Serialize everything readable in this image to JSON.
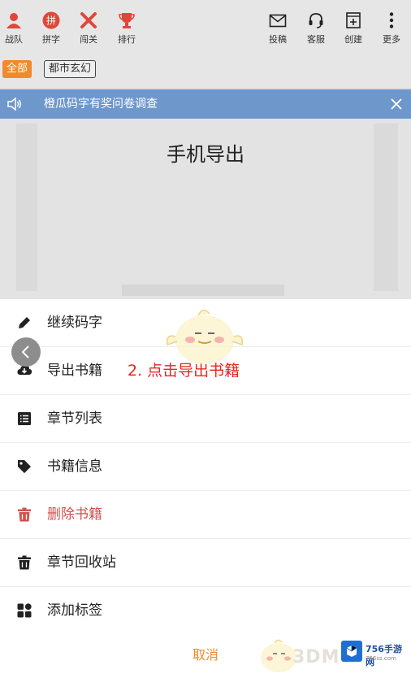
{
  "toolbar_left": [
    {
      "label": "战队",
      "icon": "team-icon"
    },
    {
      "label": "拼字",
      "icon": "pinzi-icon"
    },
    {
      "label": "闯关",
      "icon": "swords-icon"
    },
    {
      "label": "排行",
      "icon": "trophy-icon"
    }
  ],
  "toolbar_right": [
    {
      "label": "投稿",
      "icon": "mail-icon"
    },
    {
      "label": "客服",
      "icon": "headset-icon"
    },
    {
      "label": "创建",
      "icon": "create-icon"
    },
    {
      "label": "更多",
      "icon": "more-icon"
    }
  ],
  "pinzi_glyph": "拼",
  "filters": {
    "all": "全部",
    "genre": "都市玄幻"
  },
  "notice": {
    "text": "橙瓜码字有奖问卷调查"
  },
  "page_title": "手机导出",
  "menu": [
    {
      "label": "继续码字",
      "icon": "pencil-icon"
    },
    {
      "label": "导出书籍",
      "icon": "cloud-download-icon"
    },
    {
      "label": "章节列表",
      "icon": "list-icon"
    },
    {
      "label": "书籍信息",
      "icon": "tag-icon"
    },
    {
      "label": "删除书籍",
      "icon": "trash-icon"
    },
    {
      "label": "章节回收站",
      "icon": "trash-icon"
    },
    {
      "label": "添加标签",
      "icon": "grid-icon"
    }
  ],
  "hint": "2. 点击导出书籍",
  "cancel": "取消",
  "watermark": {
    "brand": "3DM",
    "site": "756手游网",
    "url": "756ss.com"
  },
  "colors": {
    "accent": "#f08a2a",
    "notice_bg": "#6e97cc",
    "danger": "#d0524d",
    "hint": "#e8261e"
  }
}
